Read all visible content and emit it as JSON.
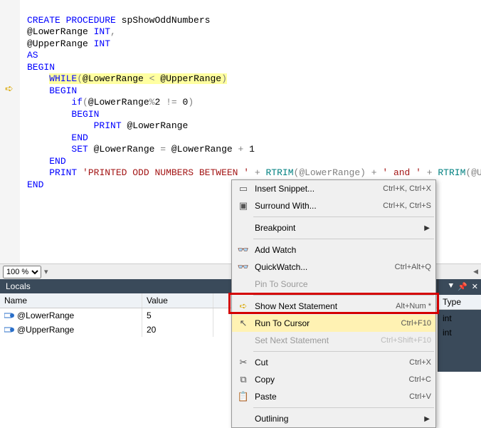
{
  "code": {
    "l1a": "CREATE",
    "l1b": "PROCEDURE",
    "l1c": " spShowOddNumbers",
    "l2a": "@LowerRange ",
    "l2b": "INT",
    "l2c": ",",
    "l3a": "@UpperRange ",
    "l3b": "INT",
    "l4": "AS",
    "l5": "BEGIN",
    "l6a": "WHILE",
    "l6b": "(",
    "l6c": "@LowerRange ",
    "l6d": "<",
    "l6e": " @UpperRange",
    "l6f": ")",
    "l7": "BEGIN",
    "l8a": "if",
    "l8b": "(",
    "l8c": "@LowerRange",
    "l8d": "%",
    "l8e": "2 ",
    "l8f": "!=",
    "l8g": " 0",
    "l8h": ")",
    "l9": "BEGIN",
    "l10a": "PRINT",
    "l10b": " @LowerRange",
    "l11": "END",
    "l12a": "SET",
    "l12b": " @LowerRange ",
    "l12c": "=",
    "l12d": " @LowerRange ",
    "l12e": "+",
    "l12f": " 1",
    "l13": "END",
    "l14a": "PRINT",
    "l14b": "'PRINTED ODD NUMBERS BETWEEN '",
    "l14c": " + ",
    "l14d": "RTRIM",
    "l14e": "(@LowerRange) + ",
    "l14f": "' and '",
    "l14g": " + ",
    "l14h": "RTRIM",
    "l14i": "(@UpperRange",
    "l15": "END"
  },
  "zoom": {
    "value": "100 %"
  },
  "locals": {
    "title": "Locals",
    "headers": {
      "name": "Name",
      "value": "Value",
      "type": "Type"
    },
    "rows": [
      {
        "name": "@LowerRange",
        "value": "5",
        "type": "int"
      },
      {
        "name": "@UpperRange",
        "value": "20",
        "type": "int"
      }
    ]
  },
  "menu": {
    "insert_snippet": "Insert Snippet...",
    "surround_with": "Surround With...",
    "breakpoint": "Breakpoint",
    "add_watch": "Add Watch",
    "quickwatch": "QuickWatch...",
    "pin_to_source": "Pin To Source",
    "show_next": "Show Next Statement",
    "run_to_cursor": "Run To Cursor",
    "set_next": "Set Next Statement",
    "cut": "Cut",
    "copy": "Copy",
    "paste": "Paste",
    "outlining": "Outlining",
    "sc": {
      "insert_snippet": "Ctrl+K, Ctrl+X",
      "surround_with": "Ctrl+K, Ctrl+S",
      "quickwatch": "Ctrl+Alt+Q",
      "show_next": "Alt+Num *",
      "run_to_cursor": "Ctrl+F10",
      "set_next": "Ctrl+Shift+F10",
      "cut": "Ctrl+X",
      "copy": "Ctrl+C",
      "paste": "Ctrl+V"
    }
  }
}
